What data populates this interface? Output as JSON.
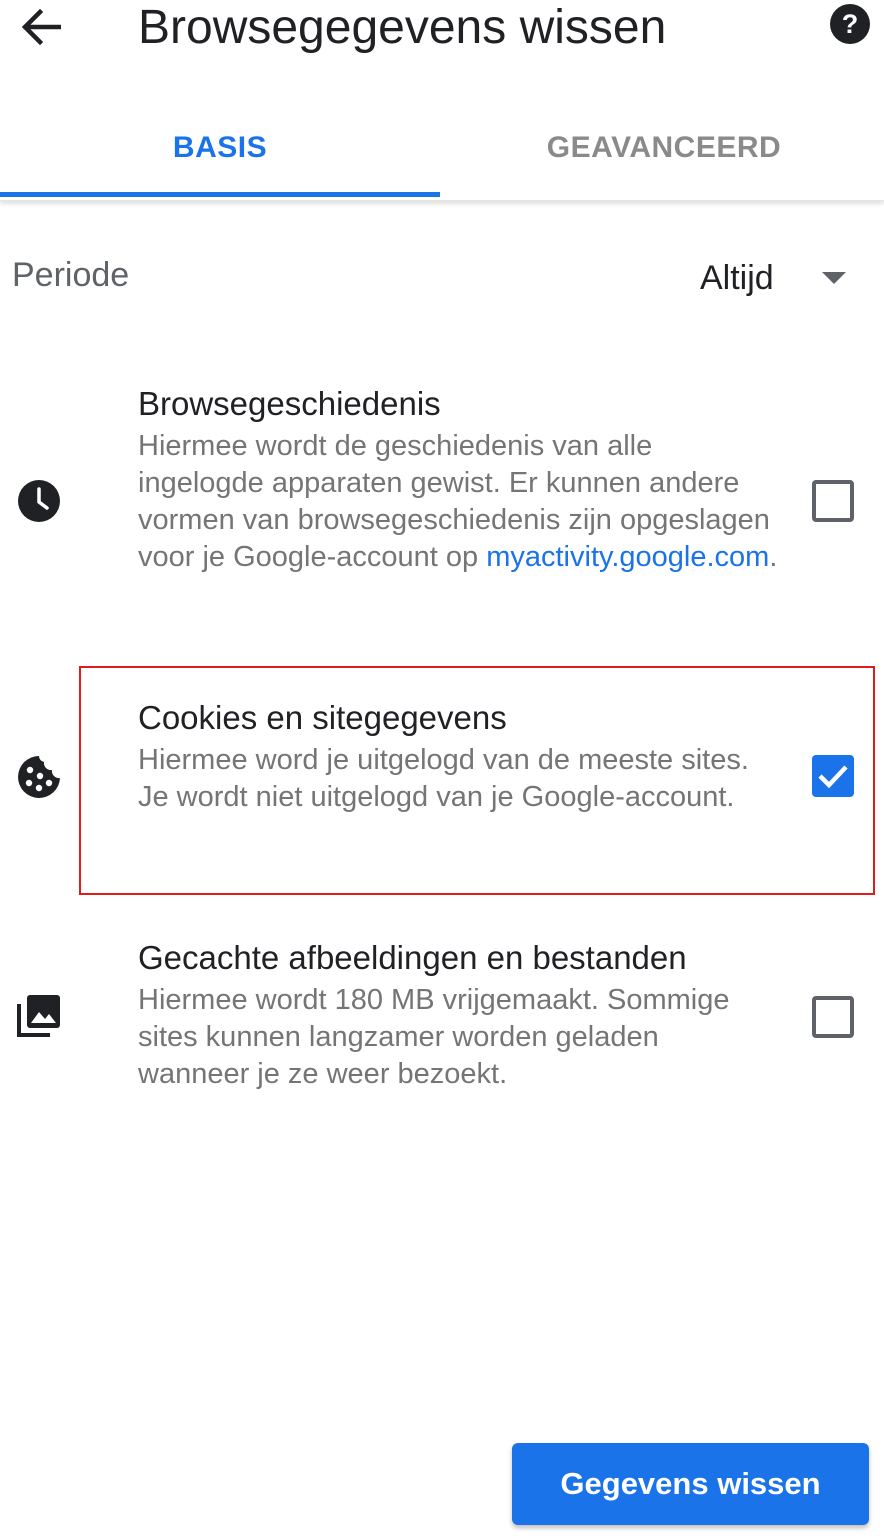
{
  "header": {
    "title": "Browsegegevens wissen",
    "back_icon": "arrow-left-icon",
    "help_icon": "help-circle-icon"
  },
  "tabs": [
    {
      "label": "BASIS",
      "active": true
    },
    {
      "label": "GEAVANCEERD",
      "active": false
    }
  ],
  "periode": {
    "label": "Periode",
    "value": "Altijd"
  },
  "options": [
    {
      "icon": "clock-icon",
      "title": "Browsegeschiedenis",
      "description": "Hiermee wordt de geschiedenis van alle ingelogde apparaten gewist. Er kunnen andere vormen van browsegeschiedenis zijn opgeslagen voor je Google-account op ",
      "link": "myactivity.google.com",
      "suffix": ".",
      "checked": false
    },
    {
      "icon": "cookie-icon",
      "title": "Cookies en sitegegevens",
      "description": "Hiermee word je uitgelogd van de meeste sites. Je wordt niet uitgelogd van je Google-account.",
      "checked": true
    },
    {
      "icon": "image-stack-icon",
      "title": "Gecachte afbeeldingen en bestanden",
      "description": "Hiermee wordt 180 MB vrijgemaakt. Sommige sites kunnen langzamer worden geladen wanneer je ze weer bezoekt.",
      "checked": false
    }
  ],
  "actions": {
    "clear_label": "Gegevens wissen"
  },
  "colors": {
    "accent": "#1a73e8",
    "highlight": "#e01b1b"
  }
}
